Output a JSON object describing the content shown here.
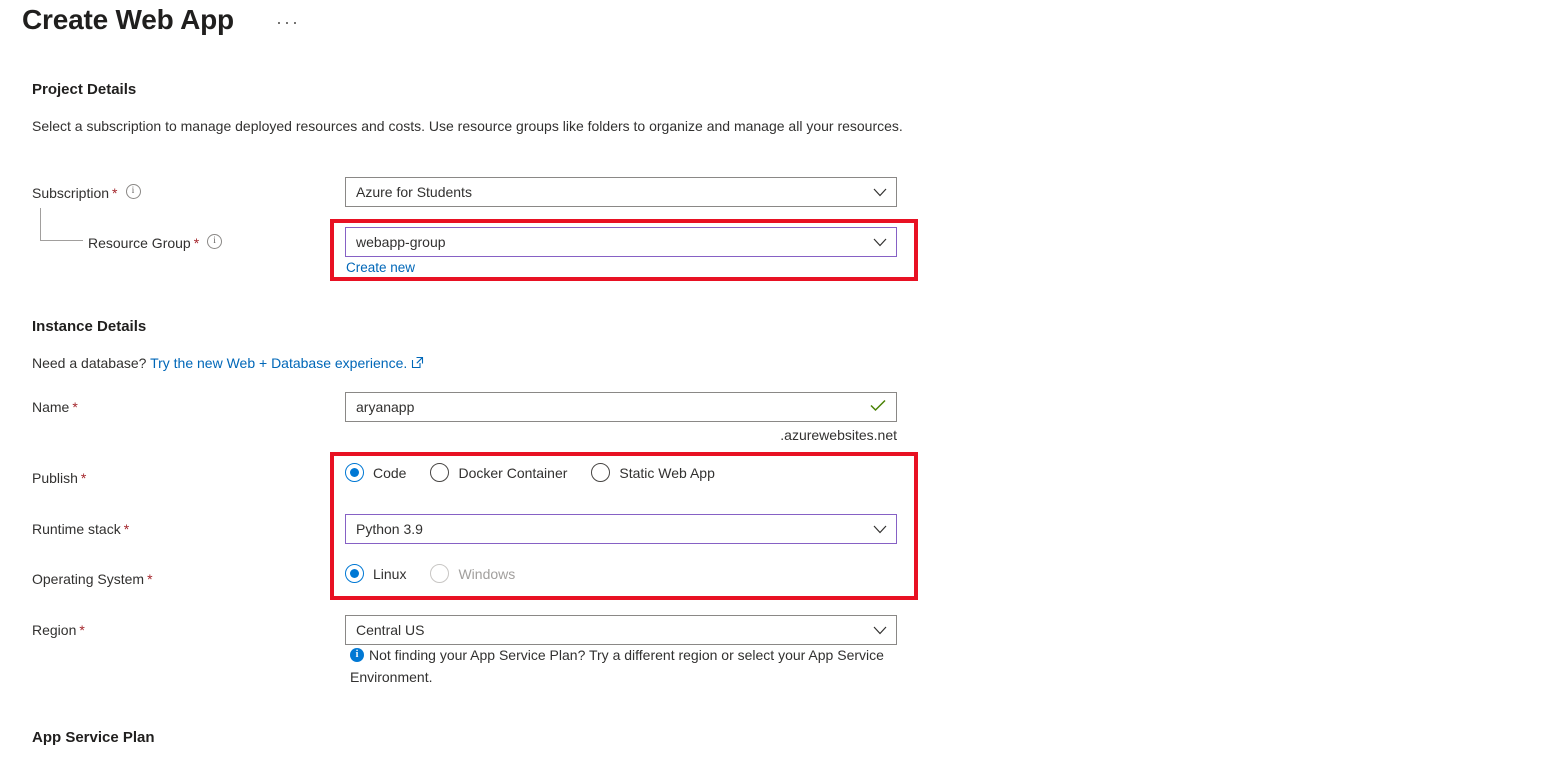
{
  "header": {
    "title": "Create Web App",
    "ellipsis": "···"
  },
  "project_details": {
    "heading": "Project Details",
    "description": "Select a subscription to manage deployed resources and costs. Use resource groups like folders to organize and manage all your resources.",
    "subscription": {
      "label": "Subscription",
      "required": "*",
      "value": "Azure for Students",
      "info_icon": "info-circle-icon",
      "chevron": "chevron-down-icon"
    },
    "resource_group": {
      "label": "Resource Group",
      "required": "*",
      "value": "webapp-group",
      "info_icon": "info-circle-icon",
      "chevron": "chevron-down-icon",
      "create_new": "Create new",
      "highlighted": true,
      "focused": true
    }
  },
  "instance_details": {
    "heading": "Instance Details",
    "need_database_prefix": "Need a database?",
    "need_database_link": "Try the new Web + Database experience.",
    "external_link_icon": "external-link-icon",
    "name": {
      "label": "Name",
      "required": "*",
      "value": "aryanapp",
      "suffix": ".azurewebsites.net",
      "valid_icon": "check-icon"
    },
    "publish": {
      "label": "Publish",
      "required": "*",
      "options": [
        {
          "label": "Code",
          "checked": true,
          "disabled": false
        },
        {
          "label": "Docker Container",
          "checked": false,
          "disabled": false
        },
        {
          "label": "Static Web App",
          "checked": false,
          "disabled": false
        }
      ]
    },
    "runtime_stack": {
      "label": "Runtime stack",
      "required": "*",
      "value": "Python 3.9",
      "chevron": "chevron-down-icon",
      "focused": true
    },
    "operating_system": {
      "label": "Operating System",
      "required": "*",
      "options": [
        {
          "label": "Linux",
          "checked": true,
          "disabled": false
        },
        {
          "label": "Windows",
          "checked": false,
          "disabled": true
        }
      ]
    },
    "region": {
      "label": "Region",
      "required": "*",
      "value": "Central US",
      "chevron": "chevron-down-icon",
      "info_icon": "info-filled-icon",
      "info_message": "Not finding your App Service Plan? Try a different region or select your App Service Environment."
    }
  },
  "app_service_plan": {
    "heading": "App Service Plan"
  },
  "colors": {
    "accent_blue": "#0078d4",
    "link_blue": "#0067b8",
    "required_red": "#a4262c",
    "annotation_red": "#e81123",
    "focus_purple": "#8661c5",
    "valid_green": "#498205",
    "border_grey": "#8a8886"
  }
}
